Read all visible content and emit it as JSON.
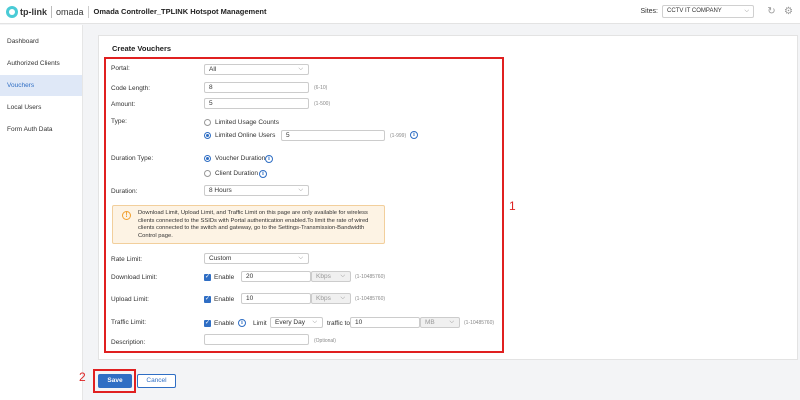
{
  "header": {
    "brand_tplink": "tp-link",
    "brand_omada": "omada",
    "title": "Omada Controller_TPLINK Hotspot Management",
    "sites_label": "Sites:",
    "sites_value": "CCTV IT COMPANY"
  },
  "sidebar": {
    "items": [
      {
        "label": "Dashboard"
      },
      {
        "label": "Authorized Clients"
      },
      {
        "label": "Vouchers"
      },
      {
        "label": "Local Users"
      },
      {
        "label": "Form Auth Data"
      }
    ]
  },
  "form": {
    "title": "Create Vouchers",
    "portal": {
      "label": "Portal:",
      "value": "All"
    },
    "code_length": {
      "label": "Code Length:",
      "value": "8",
      "hint": "(6-10)"
    },
    "amount": {
      "label": "Amount:",
      "value": "5",
      "hint": "(1-500)"
    },
    "type": {
      "label": "Type:",
      "option_usage": "Limited Usage Counts",
      "option_online": "Limited Online Users",
      "online_value": "5",
      "online_hint": "(1-999)"
    },
    "duration_type": {
      "label": "Duration Type:",
      "option_voucher": "Voucher Duration",
      "option_client": "Client Duration"
    },
    "duration": {
      "label": "Duration:",
      "value": "8 Hours"
    },
    "warning": "Download Limit, Upload Limit, and Traffic Limit on this page are only available for wireless clients connected to the SSIDs with Portal authentication enabled.To limit the rate of wired clients connected to the switch and gateway, go to the Settings-Transmission-Bandwidth Control page.",
    "rate_limit": {
      "label": "Rate Limit:",
      "value": "Custom"
    },
    "download": {
      "label": "Download Limit:",
      "enable": "Enable",
      "value": "20",
      "unit": "Kbps",
      "hint": "(1-10485760)"
    },
    "upload": {
      "label": "Upload Limit:",
      "enable": "Enable",
      "value": "10",
      "unit": "Kbps",
      "hint": "(1-10485760)"
    },
    "traffic": {
      "label": "Traffic Limit:",
      "enable": "Enable",
      "limit_label": "Limit",
      "period": "Every Day",
      "traffic_to": "traffic to",
      "value": "10",
      "unit": "MB",
      "hint": "(1-10485760)"
    },
    "description": {
      "label": "Description:",
      "placeholder": "",
      "hint": "(Optional)"
    }
  },
  "actions": {
    "save": "Save",
    "cancel": "Cancel"
  },
  "annotations": {
    "box1": "1",
    "box2": "2"
  },
  "colors": {
    "accent": "#2f6ec4",
    "annotation": "#e02020",
    "warning_bg": "#fdf3e4"
  }
}
